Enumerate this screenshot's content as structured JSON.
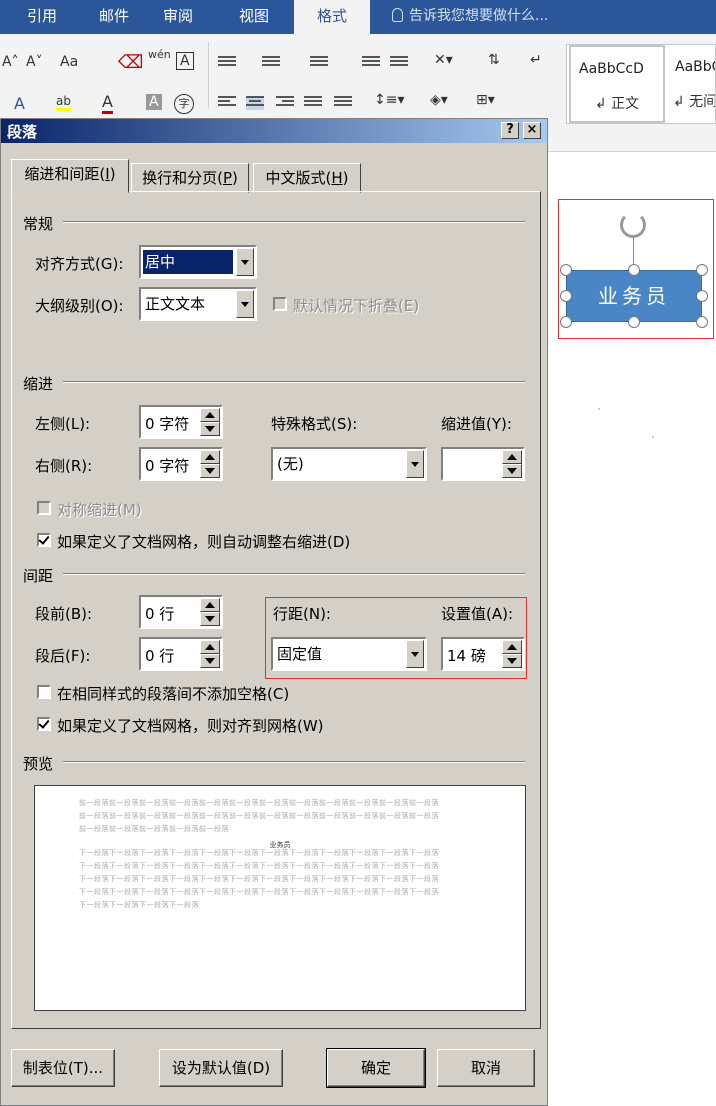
{
  "ribbon": {
    "tabs": [
      "引用",
      "邮件",
      "审阅",
      "视图",
      "格式"
    ],
    "active_tab": "格式",
    "tell_me": "告诉我您想要做什么...",
    "font_row1": [
      "A˄",
      "A˅",
      "Aa",
      "wén",
      "A"
    ],
    "font_row2": [
      "A",
      "ab",
      "A",
      "A",
      "字"
    ],
    "styles": [
      {
        "sample": "AaBbCcD",
        "name": "↲ 正文"
      },
      {
        "sample": "AaBbC",
        "name": "↲ 无间"
      }
    ],
    "colors": {
      "tab_bg": "#2b579a",
      "highlight": "#c00000"
    }
  },
  "document": {
    "shape_text": "业务员",
    "shape_color": "#4a86c5"
  },
  "dialog": {
    "title": "段落",
    "help_button": "?",
    "close_button": "×",
    "tabs": [
      {
        "label": "缩进和间距(",
        "key": "I",
        "suffix": ")"
      },
      {
        "label": "换行和分页(",
        "key": "P",
        "suffix": ")"
      },
      {
        "label": "中文版式(",
        "key": "H",
        "suffix": ")"
      }
    ],
    "general": {
      "title": "常规",
      "alignment_label": "对齐方式(G):",
      "alignment_value": "居中",
      "outline_label": "大纲级别(O):",
      "outline_value": "正文文本",
      "collapse_label": "默认情况下折叠(E)"
    },
    "indent": {
      "title": "缩进",
      "left_label": "左侧(L):",
      "left_value": "0 字符",
      "right_label": "右侧(R):",
      "right_value": "0 字符",
      "special_label": "特殊格式(S):",
      "special_value": "(无)",
      "indent_by_label": "缩进值(Y):",
      "indent_by_value": "",
      "mirror_label": "对称缩进(M)",
      "auto_adjust_label": "如果定义了文档网格，则自动调整右缩进(D)",
      "auto_adjust_checked": true
    },
    "spacing": {
      "title": "间距",
      "before_label": "段前(B):",
      "before_value": "0 行",
      "after_label": "段后(F):",
      "after_value": "0 行",
      "line_label": "行距(N):",
      "line_value": "固定值",
      "at_label": "设置值(A):",
      "at_value": "14 磅",
      "no_space_label": "在相同样式的段落间不添加空格(C)",
      "no_space_checked": false,
      "snap_grid_label": "如果定义了文档网格，则对齐到网格(W)",
      "snap_grid_checked": true
    },
    "preview": {
      "title": "预览",
      "prev_lines": [
        "前一段落前一段落前一段落前一段落前一段落前一段落前一段落前一段落前一段落前一段落前一段落前一段落",
        "前一段落前一段落前一段落前一段落前一段落前一段落前一段落前一段落前一段落前一段落前一段落前一段落",
        "前一段落前一段落前一段落前一段落前一段落"
      ],
      "sample": "业务员",
      "next_lines": [
        "下一段落下一段落下一段落下一段落下一段落下一段落下一段落下一段落下一段落下一段落下一段落下一段落",
        "下一段落下一段落下一段落下一段落下一段落下一段落下一段落下一段落下一段落下一段落下一段落下一段落",
        "下一段落下一段落下一段落下一段落下一段落下一段落下一段落下一段落下一段落下一段落下一段落下一段落",
        "下一段落下一段落下一段落下一段落下一段落下一段落下一段落下一段落下一段落下一段落下一段落下一段落",
        "下一段落下一段落下一段落下一段落"
      ]
    },
    "buttons": {
      "tabs": "制表位(T)...",
      "set_default": "设为默认值(D)",
      "ok": "确定",
      "cancel": "取消"
    }
  }
}
